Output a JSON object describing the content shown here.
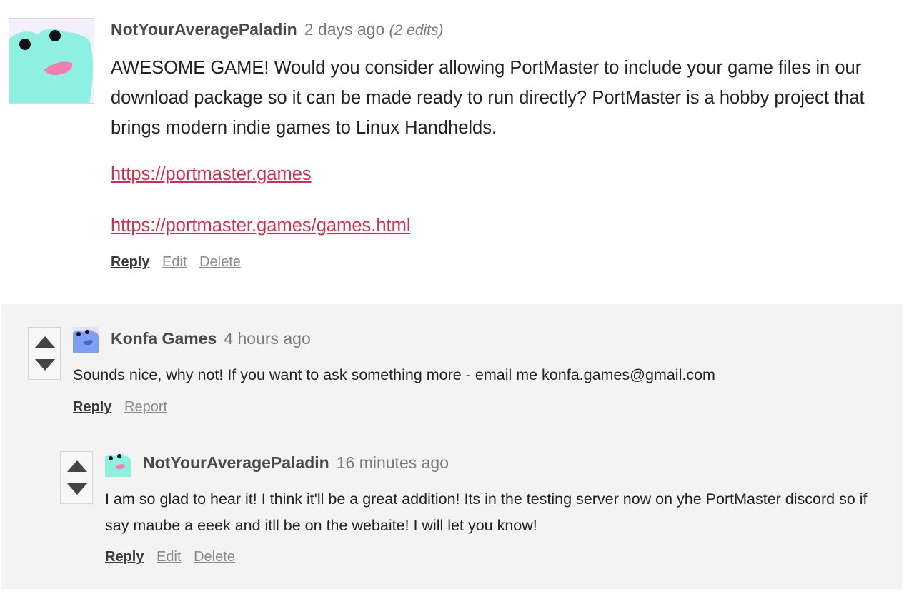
{
  "top_comment": {
    "author": "NotYourAveragePaladin",
    "time": "2 days ago",
    "edits": "(2 edits)",
    "body": "AWESOME GAME! Would you consider allowing PortMaster to include your game files in our download package so it can be made ready to run directly? PortMaster is a hobby project that brings modern indie games to Linux Handhelds.",
    "links": [
      "https://portmaster.games",
      "https://portmaster.games/games.html"
    ],
    "actions": {
      "reply": "Reply",
      "edit": "Edit",
      "delete": "Delete"
    }
  },
  "reply_1": {
    "author": "Konfa Games",
    "time": "4 hours ago",
    "body": "Sounds nice, why not! If you want to ask something more - email me konfa.games@gmail.com",
    "actions": {
      "reply": "Reply",
      "report": "Report"
    }
  },
  "reply_2": {
    "author": "NotYourAveragePaladin",
    "time": "16 minutes ago",
    "body": "I am so glad to hear it! I think it'll be a great addition! Its in the testing server now on yhe PortMaster discord  so if say maube a eeek and itll be on the webaite! I will let you know!",
    "actions": {
      "reply": "Reply",
      "edit": "Edit",
      "delete": "Delete"
    }
  },
  "colors": {
    "link": "#d32f4a",
    "reply_background": "#f3f3f3",
    "avatar_frog_mint": "#8ef0e0",
    "avatar_frog_blue": "#7fa0f0",
    "tongue_pink": "#f27fae"
  },
  "icons": [
    "frog-avatar-icon",
    "upvote-arrow-icon",
    "downvote-arrow-icon"
  ]
}
